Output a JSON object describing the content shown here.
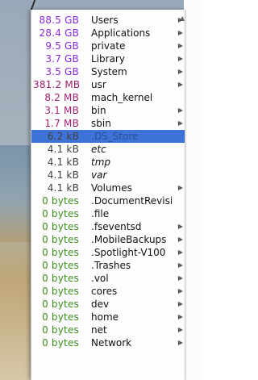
{
  "colors": {
    "gb": "#8a2be2",
    "mb": "#a01f6e",
    "kb": "#404040",
    "bytes": "#3a8e1c",
    "selection": "#3d73d6"
  },
  "menu": {
    "scroll_up_icon": "triangle-up",
    "items": [
      {
        "size": "88.5 GB",
        "name": "Users",
        "kind": "gb",
        "submenu": true,
        "italic": false,
        "selected": false
      },
      {
        "size": "28.4 GB",
        "name": "Applications",
        "kind": "gb",
        "submenu": true,
        "italic": false,
        "selected": false
      },
      {
        "size": "9.5 GB",
        "name": "private",
        "kind": "gb",
        "submenu": true,
        "italic": false,
        "selected": false
      },
      {
        "size": "3.7 GB",
        "name": "Library",
        "kind": "gb",
        "submenu": true,
        "italic": false,
        "selected": false
      },
      {
        "size": "3.5 GB",
        "name": "System",
        "kind": "gb",
        "submenu": true,
        "italic": false,
        "selected": false
      },
      {
        "size": "381.2 MB",
        "name": "usr",
        "kind": "mb",
        "submenu": true,
        "italic": false,
        "selected": false
      },
      {
        "size": "8.2 MB",
        "name": "mach_kernel",
        "kind": "mb",
        "submenu": false,
        "italic": false,
        "selected": false
      },
      {
        "size": "3.1 MB",
        "name": "bin",
        "kind": "mb",
        "submenu": true,
        "italic": false,
        "selected": false
      },
      {
        "size": "1.7 MB",
        "name": "sbin",
        "kind": "mb",
        "submenu": true,
        "italic": false,
        "selected": false
      },
      {
        "size": "6.2 kB",
        "name": ".DS_Store",
        "kind": "kb",
        "submenu": false,
        "italic": false,
        "selected": true
      },
      {
        "size": "4.1 kB",
        "name": "etc",
        "kind": "kb",
        "submenu": false,
        "italic": true,
        "selected": false
      },
      {
        "size": "4.1 kB",
        "name": "tmp",
        "kind": "kb",
        "submenu": false,
        "italic": true,
        "selected": false
      },
      {
        "size": "4.1 kB",
        "name": "var",
        "kind": "kb",
        "submenu": false,
        "italic": true,
        "selected": false
      },
      {
        "size": "4.1 kB",
        "name": "Volumes",
        "kind": "kb",
        "submenu": true,
        "italic": false,
        "selected": false
      },
      {
        "size": "0 bytes",
        "name": ".DocumentRevision",
        "kind": "bytes",
        "submenu": false,
        "italic": false,
        "selected": false
      },
      {
        "size": "0 bytes",
        "name": ".file",
        "kind": "bytes",
        "submenu": false,
        "italic": false,
        "selected": false
      },
      {
        "size": "0 bytes",
        "name": ".fseventsd",
        "kind": "bytes",
        "submenu": true,
        "italic": false,
        "selected": false
      },
      {
        "size": "0 bytes",
        "name": ".MobileBackups",
        "kind": "bytes",
        "submenu": true,
        "italic": false,
        "selected": false
      },
      {
        "size": "0 bytes",
        "name": ".Spotlight-V100",
        "kind": "bytes",
        "submenu": true,
        "italic": false,
        "selected": false
      },
      {
        "size": "0 bytes",
        "name": ".Trashes",
        "kind": "bytes",
        "submenu": true,
        "italic": false,
        "selected": false
      },
      {
        "size": "0 bytes",
        "name": ".vol",
        "kind": "bytes",
        "submenu": true,
        "italic": false,
        "selected": false
      },
      {
        "size": "0 bytes",
        "name": "cores",
        "kind": "bytes",
        "submenu": true,
        "italic": false,
        "selected": false
      },
      {
        "size": "0 bytes",
        "name": "dev",
        "kind": "bytes",
        "submenu": true,
        "italic": false,
        "selected": false
      },
      {
        "size": "0 bytes",
        "name": "home",
        "kind": "bytes",
        "submenu": true,
        "italic": false,
        "selected": false
      },
      {
        "size": "0 bytes",
        "name": "net",
        "kind": "bytes",
        "submenu": true,
        "italic": false,
        "selected": false
      },
      {
        "size": "0 bytes",
        "name": "Network",
        "kind": "bytes",
        "submenu": true,
        "italic": false,
        "selected": false
      }
    ]
  }
}
